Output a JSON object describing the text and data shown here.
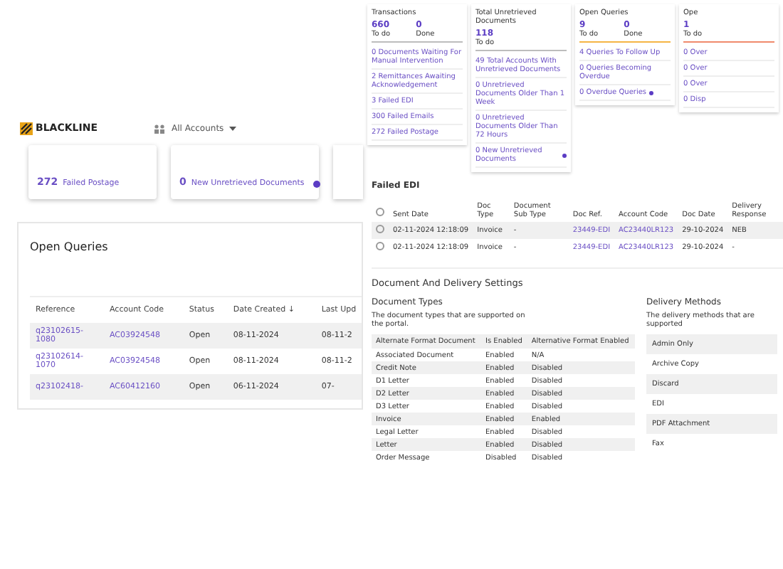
{
  "left": {
    "logo": "BLACKLINE",
    "account_selector": "All Accounts",
    "summary_cards": [
      {
        "count": "272",
        "label": "Failed Postage",
        "info": false
      },
      {
        "count": "0",
        "label": "New Unretrieved Documents",
        "info": true
      }
    ],
    "open_queries": {
      "title": "Open Queries",
      "columns": [
        "Reference",
        "Account Code",
        "Status",
        "Date Created ↓",
        "Last Upd"
      ],
      "rows": [
        [
          "q23102615-1080",
          "AC03924548",
          "Open",
          "08-11-2024",
          "08-11-2"
        ],
        [
          "q23102614-1070",
          "AC03924548",
          "Open",
          "08-11-2024",
          "08-11-2"
        ],
        [
          "q23102418-",
          "AC60412160",
          "Open",
          "06-11-2024",
          "07-"
        ]
      ]
    }
  },
  "right": {
    "overview_cards": [
      {
        "title": "Transactions",
        "color": "#bdbdbd",
        "todo": "660",
        "todo_label": "To do",
        "done": "0",
        "done_label": "Done",
        "items": [
          {
            "count": "0",
            "label": "Documents Waiting For Manual Intervention",
            "info": false
          },
          {
            "count": "2",
            "label": "Remittances Awaiting Acknowledgement",
            "info": false
          },
          {
            "count": "3",
            "label": "Failed EDI",
            "info": false
          },
          {
            "count": "300",
            "label": "Failed Emails",
            "info": false
          },
          {
            "count": "272",
            "label": "Failed Postage",
            "info": false
          }
        ]
      },
      {
        "title": "Total Unretrieved Documents",
        "color": "#bdbdbd",
        "todo": "118",
        "todo_label": "To do",
        "items": [
          {
            "count": "49",
            "label": "Total Accounts With Unretrieved Documents",
            "info": false
          },
          {
            "count": "0",
            "label": "Unretrieved Documents Older Than 1 Week",
            "info": false
          },
          {
            "count": "0",
            "label": "Unretrieved Documents Older Than 72 Hours",
            "info": false
          },
          {
            "count": "0",
            "label": "New Unretrieved Documents",
            "info": true
          }
        ]
      },
      {
        "title": "Open Queries",
        "color": "#f5b544",
        "todo": "9",
        "todo_label": "To do",
        "done": "0",
        "done_label": "Done",
        "items": [
          {
            "count": "4",
            "label": "Queries To Follow Up",
            "info": false
          },
          {
            "count": "0",
            "label": "Queries Becoming Overdue",
            "info": false
          },
          {
            "count": "0",
            "label": "Overdue Queries",
            "info": true
          }
        ]
      },
      {
        "title": "Ope",
        "color": "#f08a6c",
        "todo": "1",
        "todo_label": "To do",
        "items": [
          {
            "count": "0",
            "label": "Over",
            "info": false
          },
          {
            "count": "0",
            "label": "Over",
            "info": false
          },
          {
            "count": "0",
            "label": "Over",
            "info": false
          },
          {
            "count": "0",
            "label": "Disp",
            "info": false
          }
        ]
      }
    ],
    "failed_edi": {
      "title": "Failed EDI",
      "select_all_checked": false,
      "columns": [
        "Sent Date",
        "Doc Type",
        "Document Sub Type",
        "Doc Ref.",
        "Account Code",
        "Doc Date",
        "Delivery Response"
      ],
      "rows": [
        {
          "checked": false,
          "cells": [
            "02-11-2024 12:18:09",
            "Invoice",
            "-",
            "23449-EDI",
            "AC23440LR123",
            "29-10-2024",
            "NEB"
          ]
        },
        {
          "checked": false,
          "cells": [
            "02-11-2024 12:18:09",
            "Invoice",
            "-",
            "23449-EDI",
            "AC23440LR123",
            "29-10-2024",
            "-"
          ]
        }
      ]
    },
    "settings": {
      "title": "Document And Delivery Settings",
      "document_types": {
        "title": "Document Types",
        "description": "The document types that are supported on the portal.",
        "columns": [
          "Alternate Format Document",
          "Is Enabled",
          "Alternative Format Enabled"
        ],
        "rows": [
          [
            "Associated Document",
            "Enabled",
            "N/A"
          ],
          [
            "Credit Note",
            "Enabled",
            "Disabled"
          ],
          [
            "D1 Letter",
            "Enabled",
            "Disabled"
          ],
          [
            "D2 Letter",
            "Enabled",
            "Disabled"
          ],
          [
            "D3 Letter",
            "Enabled",
            "Disabled"
          ],
          [
            "Invoice",
            "Enabled",
            "Enabled"
          ],
          [
            "Legal Letter",
            "Enabled",
            "Disabled"
          ],
          [
            "Letter",
            "Enabled",
            "Disabled"
          ],
          [
            "Order Message",
            "Disabled",
            "Disabled"
          ]
        ]
      },
      "delivery_methods": {
        "title": "Delivery Methods",
        "description": "The delivery methods that are supported",
        "items": [
          "Admin Only",
          "Archive Copy",
          "Discard",
          "EDI",
          "PDF Attachment",
          "Fax"
        ]
      }
    }
  }
}
